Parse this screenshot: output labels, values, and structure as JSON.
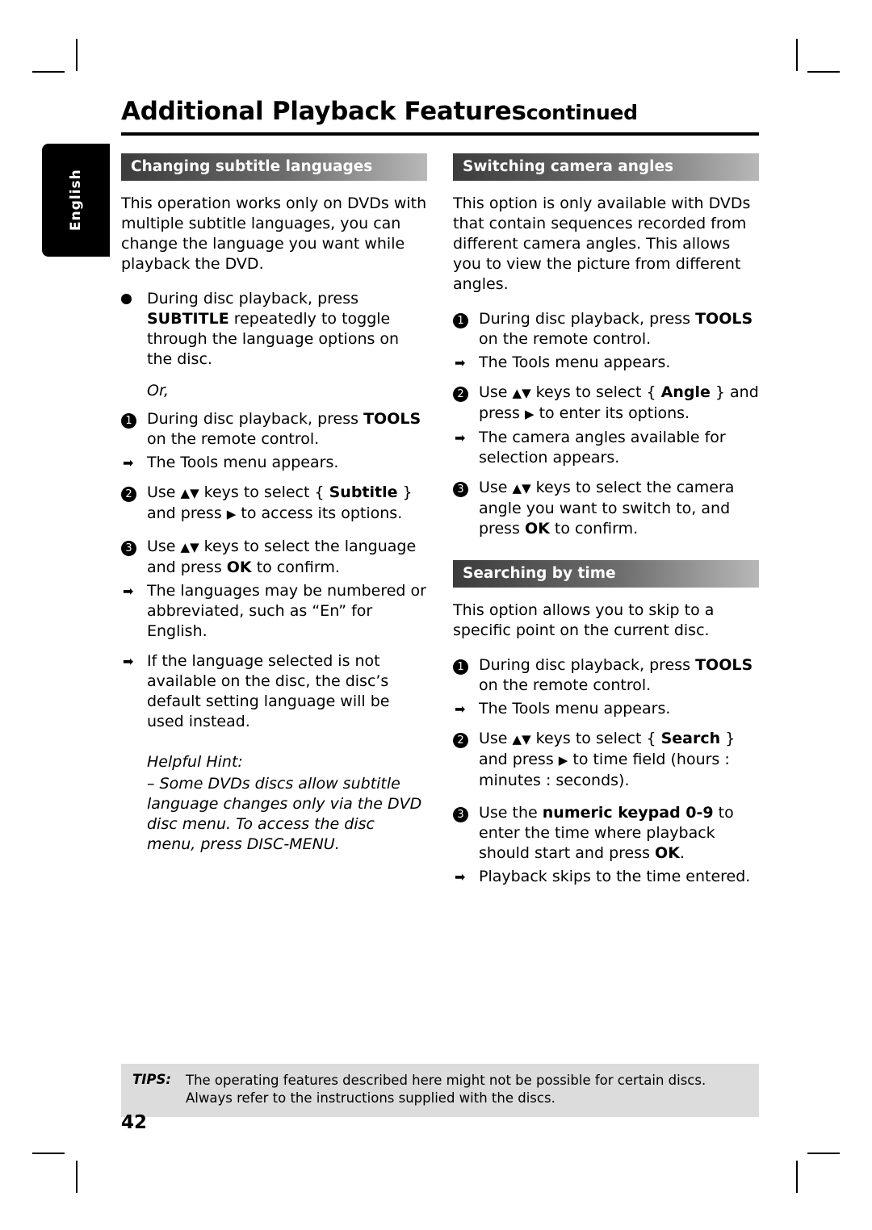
{
  "header": {
    "title": "Additional Playback Features",
    "continued": "continued"
  },
  "language_tab": "English",
  "left_column": {
    "section1": {
      "bar_title": "Changing subtitle languages",
      "intro": "This operation works only on DVDs with multiple subtitle languages, you can change the language you want while playback the DVD.",
      "bullet": {
        "text_1": "During disc playback, press ",
        "bold_1": "SUBTITLE",
        "text_2": " repeatedly to toggle through the language options on the disc."
      },
      "or": "Or,",
      "step1": {
        "num": "1",
        "text_1": "During disc playback, press ",
        "bold_1": "TOOLS",
        "text_2": " on the remote control.",
        "arrow": "The Tools menu appears."
      },
      "step2": {
        "num": "2",
        "text_1": "Use ",
        "keys": "▲▼",
        "text_2": " keys to select { ",
        "bold_1": "Subtitle",
        "text_3": " } and press ",
        "arrow_key": "▶",
        "text_4": " to access its options."
      },
      "step3": {
        "num": "3",
        "text_1": "Use ",
        "keys": "▲▼",
        "text_2": " keys to select the language and press ",
        "bold_1": "OK",
        "text_3": " to confirm.",
        "arrow_1": "The languages may be numbered or abbreviated, such as “En” for English.",
        "arrow_2": "If the language selected is not available on the disc, the disc’s default setting language will be used instead."
      },
      "hint_title": "Helpful Hint:",
      "hint_body": "– Some DVDs discs allow subtitle language changes only via the DVD disc menu. To access the disc menu, press DISC-MENU."
    }
  },
  "right_column": {
    "section1": {
      "bar_title": "Switching camera angles",
      "intro": "This option is only available with DVDs that contain sequences recorded from different camera angles. This allows you to view the picture from different angles.",
      "step1": {
        "num": "1",
        "text_1": "During disc playback, press ",
        "bold_1": "TOOLS",
        "text_2": " on the remote control.",
        "arrow": "The Tools menu appears."
      },
      "step2": {
        "num": "2",
        "text_1": "Use ",
        "keys": "▲▼",
        "text_2": " keys to select { ",
        "bold_1": "Angle",
        "text_3": " } and press ",
        "arrow_key": "▶",
        "text_4": " to enter its options.",
        "arrow": "The camera angles available for selection appears."
      },
      "step3": {
        "num": "3",
        "text_1": "Use ",
        "keys": "▲▼",
        "text_2": " keys to select the camera angle you want to switch to, and press ",
        "bold_1": "OK",
        "text_3": " to confirm."
      }
    },
    "section2": {
      "bar_title": "Searching by time",
      "intro": "This option allows you to skip to a specific point on the current disc.",
      "step1": {
        "num": "1",
        "text_1": "During disc playback, press ",
        "bold_1": "TOOLS",
        "text_2": " on the remote control.",
        "arrow": "The Tools menu appears."
      },
      "step2": {
        "num": "2",
        "text_1": "Use ",
        "keys": "▲▼",
        "text_2": " keys to select { ",
        "bold_1": "Search",
        "text_3": " } and press ",
        "arrow_key": "▶",
        "text_4": " to time field (hours : minutes : seconds)."
      },
      "step3": {
        "num": "3",
        "text_1": "Use the ",
        "bold_1": "numeric keypad 0-9",
        "text_2": " to enter the time where playback should start and press ",
        "bold_2": "OK",
        "text_3": ".",
        "arrow": "Playback skips to the time entered."
      }
    }
  },
  "tips": {
    "label": "TIPS:",
    "line1": "The operating features described here might not be possible for certain discs.",
    "line2": "Always refer to the instructions supplied with the discs."
  },
  "page_number": "42"
}
